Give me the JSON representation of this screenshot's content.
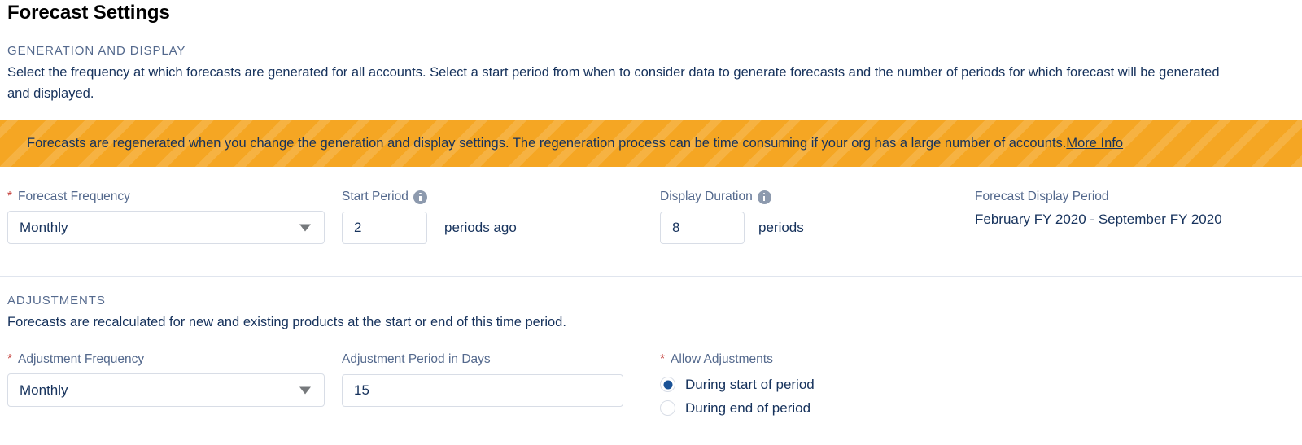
{
  "page": {
    "title": "Forecast Settings"
  },
  "generation": {
    "eyebrow": "GENERATION AND DISPLAY",
    "description": "Select the frequency at which forecasts are generated for all accounts. Select a start period from when to consider data to generate forecasts and the number of periods for which forecast will be generated and displayed.",
    "banner": {
      "text": "Forecasts are regenerated when you change the generation and display settings. The regeneration process can be time consuming if your org has a large number of accounts.",
      "link_label": "More Info",
      "background_color": "#f5a623"
    },
    "fields": {
      "forecast_frequency": {
        "label": "Forecast Frequency",
        "required_marker": "*",
        "value": "Monthly",
        "options": [
          "Monthly"
        ]
      },
      "start_period": {
        "label": "Start Period",
        "value": "2",
        "suffix": "periods ago",
        "has_info_icon": true
      },
      "display_duration": {
        "label": "Display Duration",
        "value": "8",
        "suffix": "periods",
        "has_info_icon": true
      },
      "forecast_display_period": {
        "label": "Forecast Display Period",
        "value": "February FY 2020 - September FY 2020"
      }
    }
  },
  "adjustments": {
    "eyebrow": "ADJUSTMENTS",
    "description": "Forecasts are recalculated for new and existing products at the start or end of this time period.",
    "fields": {
      "adjustment_frequency": {
        "label": "Adjustment Frequency",
        "required_marker": "*",
        "value": "Monthly",
        "options": [
          "Monthly"
        ]
      },
      "adjustment_period_days": {
        "label": "Adjustment Period in Days",
        "value": "15"
      },
      "allow_adjustments": {
        "label": "Allow Adjustments",
        "required_marker": "*",
        "selected": "During start of period",
        "options": [
          {
            "label": "During start of period",
            "checked": true
          },
          {
            "label": "During end of period",
            "checked": false
          }
        ]
      }
    }
  },
  "colors": {
    "required_star": "#c23934",
    "label_text": "#54698d",
    "body_text": "#16325c",
    "radio_selected": "#1a5296",
    "banner_bg": "#f5a623",
    "input_border": "#d8dde6",
    "divider": "#e0e5ee"
  }
}
